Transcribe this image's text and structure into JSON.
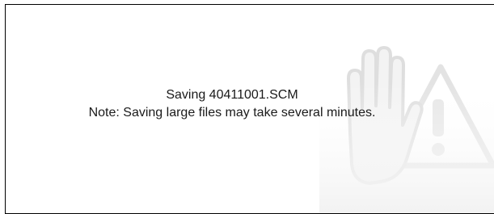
{
  "dialog": {
    "status_line": "Saving 40411001.SCM",
    "note_line": "Note: Saving large files may take several minutes.",
    "watermark_icon": "stop-hand-warning-icon",
    "watermark_color": "#e6e6e6"
  }
}
